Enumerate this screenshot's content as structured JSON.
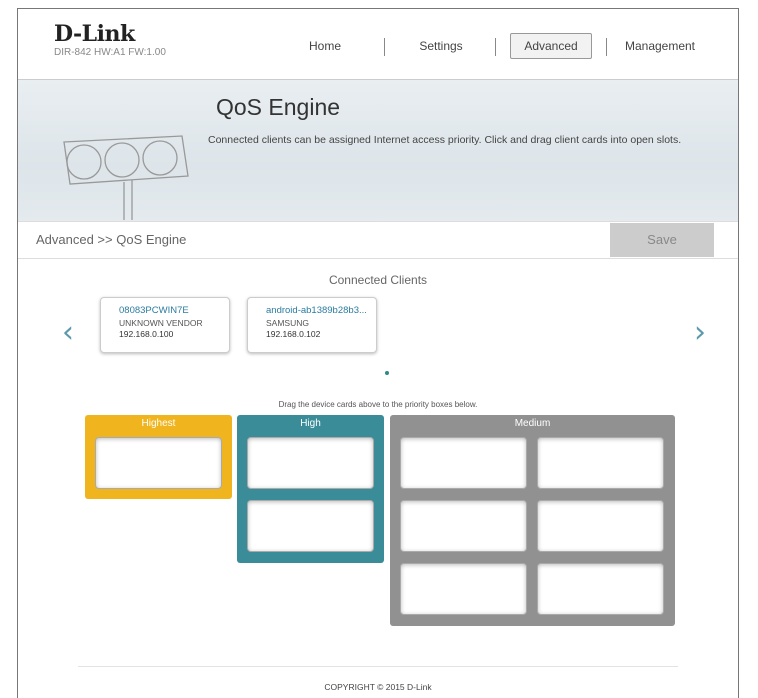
{
  "brand": {
    "logo": "D-Link",
    "model_info": "DIR-842  HW:A1  FW:1.00"
  },
  "nav": {
    "items": [
      "Home",
      "Settings",
      "Advanced",
      "Management"
    ],
    "active": "Advanced"
  },
  "banner": {
    "title": "QoS Engine",
    "description": "Connected clients can be assigned Internet access priority. Click and drag client cards into open slots.",
    "icon": "traffic-light-icon"
  },
  "breadcrumb": "Advanced >> QoS Engine",
  "save_label": "Save",
  "clients": {
    "title": "Connected Clients",
    "prev_icon": "chevron-left-icon",
    "next_icon": "chevron-right-icon",
    "cards": [
      {
        "name": "08083PCWIN7E",
        "vendor": "UNKNOWN VENDOR",
        "ip": "192.168.0.100"
      },
      {
        "name": "android-ab1389b28b3...",
        "vendor": "SAMSUNG",
        "ip": "192.168.0.102"
      }
    ],
    "pages": 1,
    "current_page": 1
  },
  "hint": "Drag the device cards above to the priority boxes below.",
  "priority": [
    {
      "label": "Highest",
      "color": "#f0b51e",
      "slots": 1
    },
    {
      "label": "High",
      "color": "#3a8c99",
      "slots": 2
    },
    {
      "label": "Medium",
      "color": "#919191",
      "slots": 6
    }
  ],
  "footer": "COPYRIGHT © 2015 D-Link"
}
